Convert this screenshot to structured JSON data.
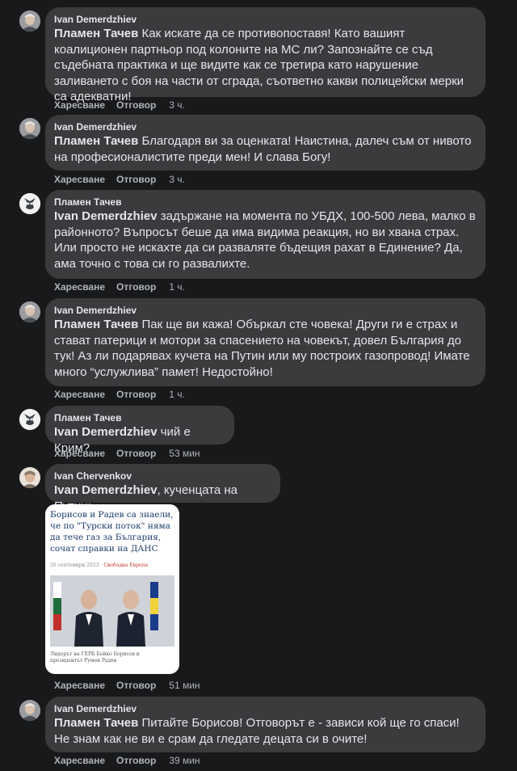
{
  "actions": {
    "like": "Харесване",
    "reply": "Отговор"
  },
  "comments": [
    {
      "author": "Ivan Demerdzhiev",
      "mention": "Пламен Тачев",
      "text": " Как искате да се противопоставя! Като вашият коалиционен партньор под колоните на МС ли? Запознайте се съд съдебната практика и ще видите как се третира като нарушение заливането с боя на части от сграда, съответно какви полицейски мерки са адекватни!",
      "time": "3 ч."
    },
    {
      "author": "Ivan Demerdzhiev",
      "mention": "Пламен Тачев",
      "text": " Благодаря ви за оценката! Наистина, далеч съм от нивото на професионалистите преди мен! И слава Богу!",
      "time": "3 ч."
    },
    {
      "author": "Пламен Тачев",
      "mention": "Ivan Demerdzhiev",
      "text": " задържане на момента по УБДХ, 100-500 лева, малко в районното? Въпросът беше да има видима реакция, но ви хвана страх. Или просто не искахте да си разваляте бъдещия рахат в Единение? Да, ама точно с това си го развалихте.",
      "time": "1 ч."
    },
    {
      "author": "Ivan Demerdzhiev",
      "mention": "Пламен Тачев",
      "text": " Пак ще ви кажа! Объркал сте човека! Други ги е страх и стават патерици и мотори за спасението на човекът, довел България до тук! Аз ли подарявах кучета на Путин или му построих газопровод! Имате много “услужлива” памет! Недостойно!",
      "time": "1 ч."
    },
    {
      "author": "Пламен Тачев",
      "mention": "Ivan Demerdzhiev",
      "text": " чий е Крим?",
      "time": "53 мин"
    },
    {
      "author": "Ivan Chervenkov",
      "mention": "Ivan Demerdzhiev",
      "text": ", кученцата на Путин:",
      "time": "51 мин",
      "attachment": {
        "headline": "Борисов и Радев са знаели, че по \"Турски поток\" няма да тече газ за България, сочат справки на ДАНС",
        "date": "26 септември 2023",
        "source": "Свободна Европа",
        "caption": "Лидерът на ГЕРБ Бойко Борисов и президентът Румен Радев"
      }
    },
    {
      "author": "Ivan Demerdzhiev",
      "mention": "Пламен Тачев",
      "text": " Питайте Борисов! Отговорът е - зависи кой ще го спаси! Не знам как не ви е срам да гледате децата си в очите!",
      "time": "39 мин"
    }
  ],
  "colors": {
    "background": "#18191a",
    "bubble": "#3a3b3c",
    "text": "#e4e6eb",
    "secondary": "#b0b3b8"
  }
}
